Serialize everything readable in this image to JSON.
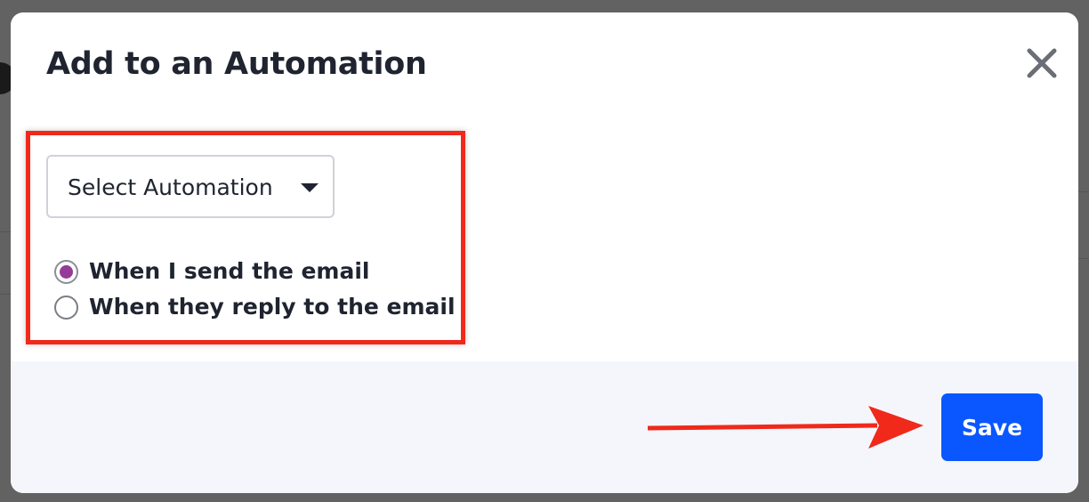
{
  "modal": {
    "title": "Add to an Automation",
    "close_icon": "close-icon",
    "select": {
      "value": "Select Automation",
      "caret_icon": "caret-down-icon"
    },
    "radio_options": [
      {
        "label": "When I send the email",
        "checked": true
      },
      {
        "label": "When they reply to the email",
        "checked": false
      }
    ],
    "footer": {
      "save_label": "Save"
    }
  },
  "annotations": {
    "highlight_color": "#f0291b",
    "arrow_icon": "arrow-right-icon"
  },
  "colors": {
    "primary_button": "#0a57ff",
    "radio_checked": "#943c98",
    "footer_bg": "#f5f6fb"
  }
}
